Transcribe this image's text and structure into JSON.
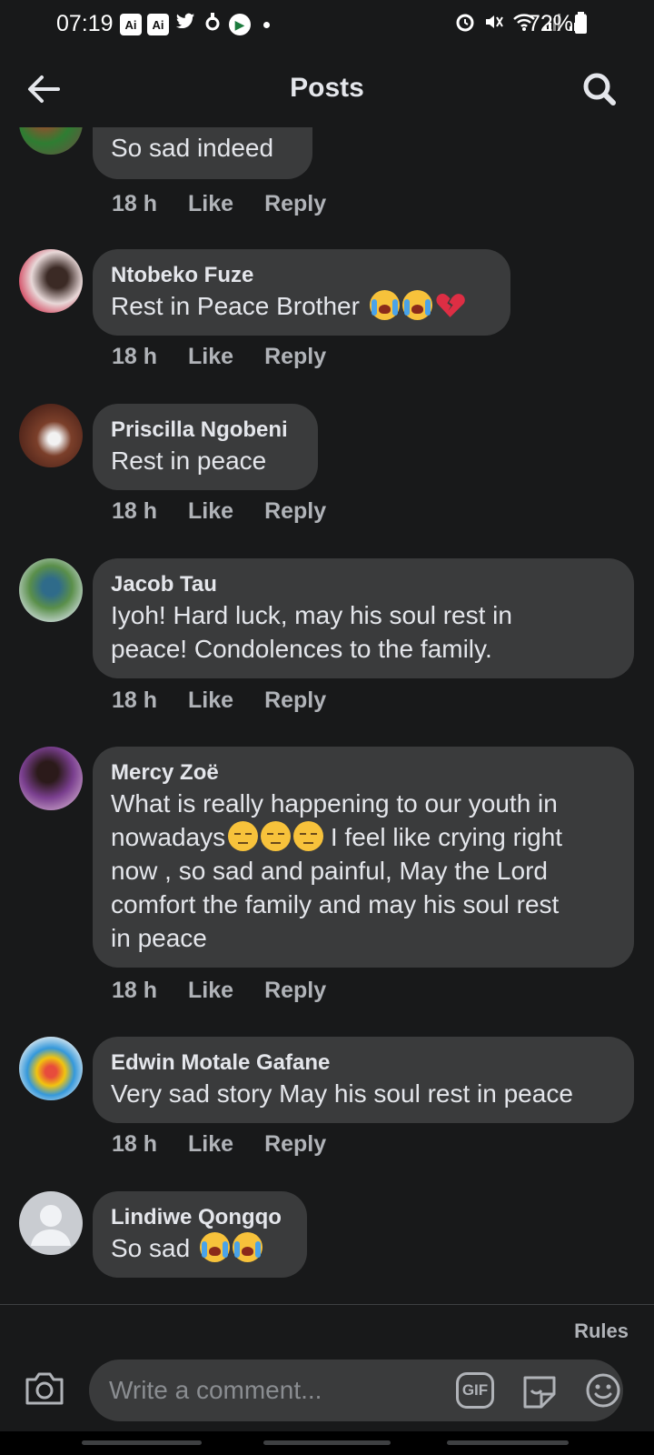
{
  "status_bar": {
    "time": "07:19",
    "app_icon_1": "Ai",
    "app_icon_2": "Ai",
    "icons_left": [
      "twitter-icon",
      "recycle-icon",
      "play-icon"
    ],
    "icons_right": [
      "alarm-icon",
      "mute-icon",
      "wifi-icon",
      "signal-icon",
      "signal-icon"
    ],
    "battery": "72%"
  },
  "header": {
    "title": "Posts"
  },
  "comments": [
    {
      "name": "",
      "text": "So sad indeed",
      "time": "18 h",
      "like": "Like",
      "reply": "Reply"
    },
    {
      "name": "Ntobeko Fuze",
      "text": "Rest in Peace Brother",
      "emoji": [
        "crying-face",
        "crying-face",
        "broken-heart"
      ],
      "time": "18 h",
      "like": "Like",
      "reply": "Reply"
    },
    {
      "name": "Priscilla Ngobeni",
      "text": "Rest in peace",
      "time": "18 h",
      "like": "Like",
      "reply": "Reply"
    },
    {
      "name": "Jacob Tau",
      "text_line1": "Iyoh! Hard luck, may his soul rest in",
      "text_line2": "peace! Condolences to the family.",
      "time": "18 h",
      "like": "Like",
      "reply": "Reply"
    },
    {
      "name": "Mercy Zoë",
      "text_line1": "What is really happening to our youth in",
      "text_line2a": "nowadays",
      "text_line2b": " I feel like crying right",
      "text_line3": "now , so sad and painful, May the Lord",
      "text_line4": "comfort the family and may his soul rest",
      "text_line5": "in peace",
      "emoji": [
        "pensive-face",
        "pensive-face",
        "pensive-face"
      ],
      "time": "18 h",
      "like": "Like",
      "reply": "Reply"
    },
    {
      "name": "Edwin Motale Gafane",
      "text": "Very sad story May his soul rest in peace",
      "time": "18 h",
      "like": "Like",
      "reply": "Reply"
    },
    {
      "name": "Lindiwe Qongqo",
      "text": "So sad",
      "emoji": [
        "crying-face",
        "crying-face"
      ]
    }
  ],
  "composer": {
    "rules": "Rules",
    "placeholder": "Write a comment...",
    "gif": "GIF"
  },
  "colors": {
    "background": "#18191a",
    "bubble": "#3a3b3c",
    "text": "#e4e6eb",
    "secondary_text": "#b0b3b8"
  }
}
